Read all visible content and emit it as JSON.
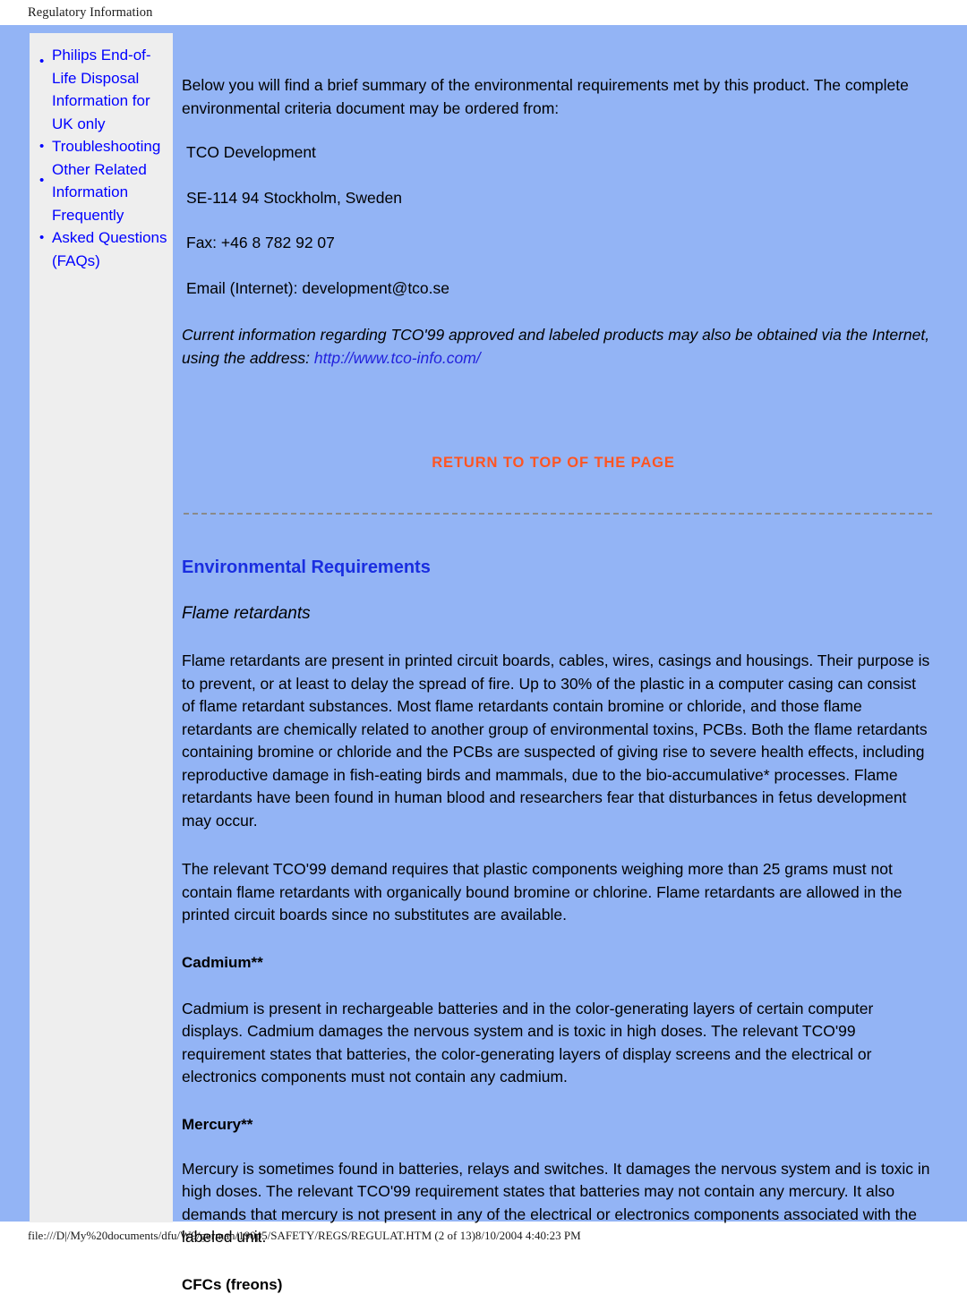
{
  "header": {
    "title": "Regulatory Information"
  },
  "sidebar": {
    "items": [
      {
        "label": "Philips End-of-Life Disposal Information for UK only"
      },
      {
        "label": "Troubleshooting"
      },
      {
        "label": "Other Related Information"
      },
      {
        "label": "Frequently Asked Questions (FAQs)"
      }
    ]
  },
  "main": {
    "lead_paragraph": "Below you will find a brief summary of the environmental requirements met by this product. The complete environmental criteria document may be ordered from:",
    "address": {
      "organization": "TCO Development",
      "postal": "SE-114 94 Stockholm, Sweden",
      "fax": "Fax: +46 8 782 92 07",
      "email": "Email (Internet): development@tco.se"
    },
    "italic_note": {
      "text_before": "Current information regarding TCO'99 approved and labeled products may also be obtained via the Internet, using the address: ",
      "link_text": "http://www.tco-info.com/"
    },
    "return_to_top": "RETURN TO TOP OF THE PAGE",
    "section_title": "Environmental Requirements",
    "flame_subtitle": "Flame retardants",
    "flame_paragraph_1": "Flame retardants are present in printed circuit boards, cables, wires, casings and housings. Their purpose is to prevent, or at least to delay the spread of fire. Up to 30% of the plastic in a computer casing can consist of flame retardant substances. Most flame retardants contain bromine or chloride, and those flame retardants are chemically related to another group of environmental toxins, PCBs. Both the flame retardants containing bromine or chloride and the PCBs are suspected of giving rise to severe health effects, including reproductive damage in fish-eating birds and mammals, due to the bio-accumulative* processes. Flame retardants have been found in human blood and researchers fear that disturbances in fetus development may occur.",
    "flame_paragraph_2": "The relevant TCO'99 demand requires that plastic components weighing more than 25 grams must not contain flame retardants with organically bound bromine or chlorine. Flame retardants are allowed in the printed circuit boards since no substitutes are available.",
    "cadmium_heading": "Cadmium**",
    "cadmium_paragraph": "Cadmium is present in rechargeable batteries and in the color-generating layers of certain computer displays. Cadmium damages the nervous system and is toxic in high doses. The relevant TCO'99 requirement states that batteries, the color-generating layers of display screens and the electrical or electronics components must not contain any cadmium.",
    "mercury_heading": "Mercury**",
    "mercury_paragraph": "Mercury is sometimes found in batteries, relays and switches. It damages the nervous system and is toxic in high doses. The relevant TCO'99 requirement states that batteries may not contain any mercury. It also demands that mercury is not present in any of the electrical or electronics components associated with the labeled unit.",
    "cfcs_heading": "CFCs (freons)"
  },
  "footer": {
    "path": "file:///D|/My%20documents/dfu/W9/german/190p5/SAFETY/REGS/REGULAT.HTM (2 of 13)8/10/2004 4:40:23 PM"
  },
  "colors": {
    "page_background": "#93b4f5",
    "sidebar_background": "#eeeeee",
    "link": "#0000ff",
    "return_top_link": "#ff5522",
    "section_heading": "#1a2ee0",
    "body_text": "#000000"
  }
}
